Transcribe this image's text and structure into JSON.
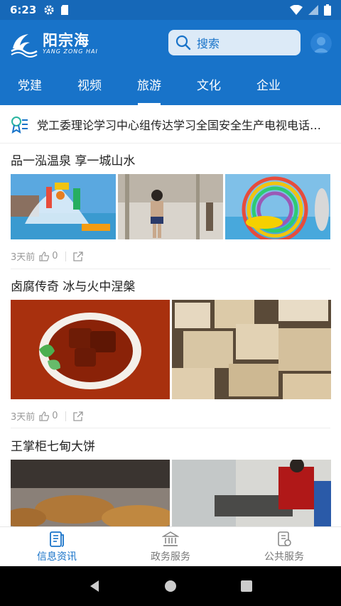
{
  "status": {
    "time": "6:23"
  },
  "header": {
    "logo_cn": "阳宗海",
    "logo_en": "YANG ZONG HAI",
    "search_placeholder": "搜索"
  },
  "tabs": [
    {
      "label": "党建"
    },
    {
      "label": "视频"
    },
    {
      "label": "旅游",
      "active": true
    },
    {
      "label": "文化"
    },
    {
      "label": "企业"
    }
  ],
  "notice": {
    "text": "党工委理论学习中心组传达学习全国安全生产电视电话会议精神"
  },
  "articles": [
    {
      "title": "品一泓温泉 享一城山水",
      "time": "3天前",
      "likes": "0"
    },
    {
      "title": "卤腐传奇 冰与火中涅槃",
      "time": "3天前",
      "likes": "0"
    },
    {
      "title": "王掌柜七甸大饼"
    }
  ],
  "bottom_nav": [
    {
      "label": "信息资讯",
      "active": true
    },
    {
      "label": "政务服务"
    },
    {
      "label": "公共服务"
    }
  ],
  "colors": {
    "brand": "#1873c9",
    "status_bar": "#1668b8"
  }
}
